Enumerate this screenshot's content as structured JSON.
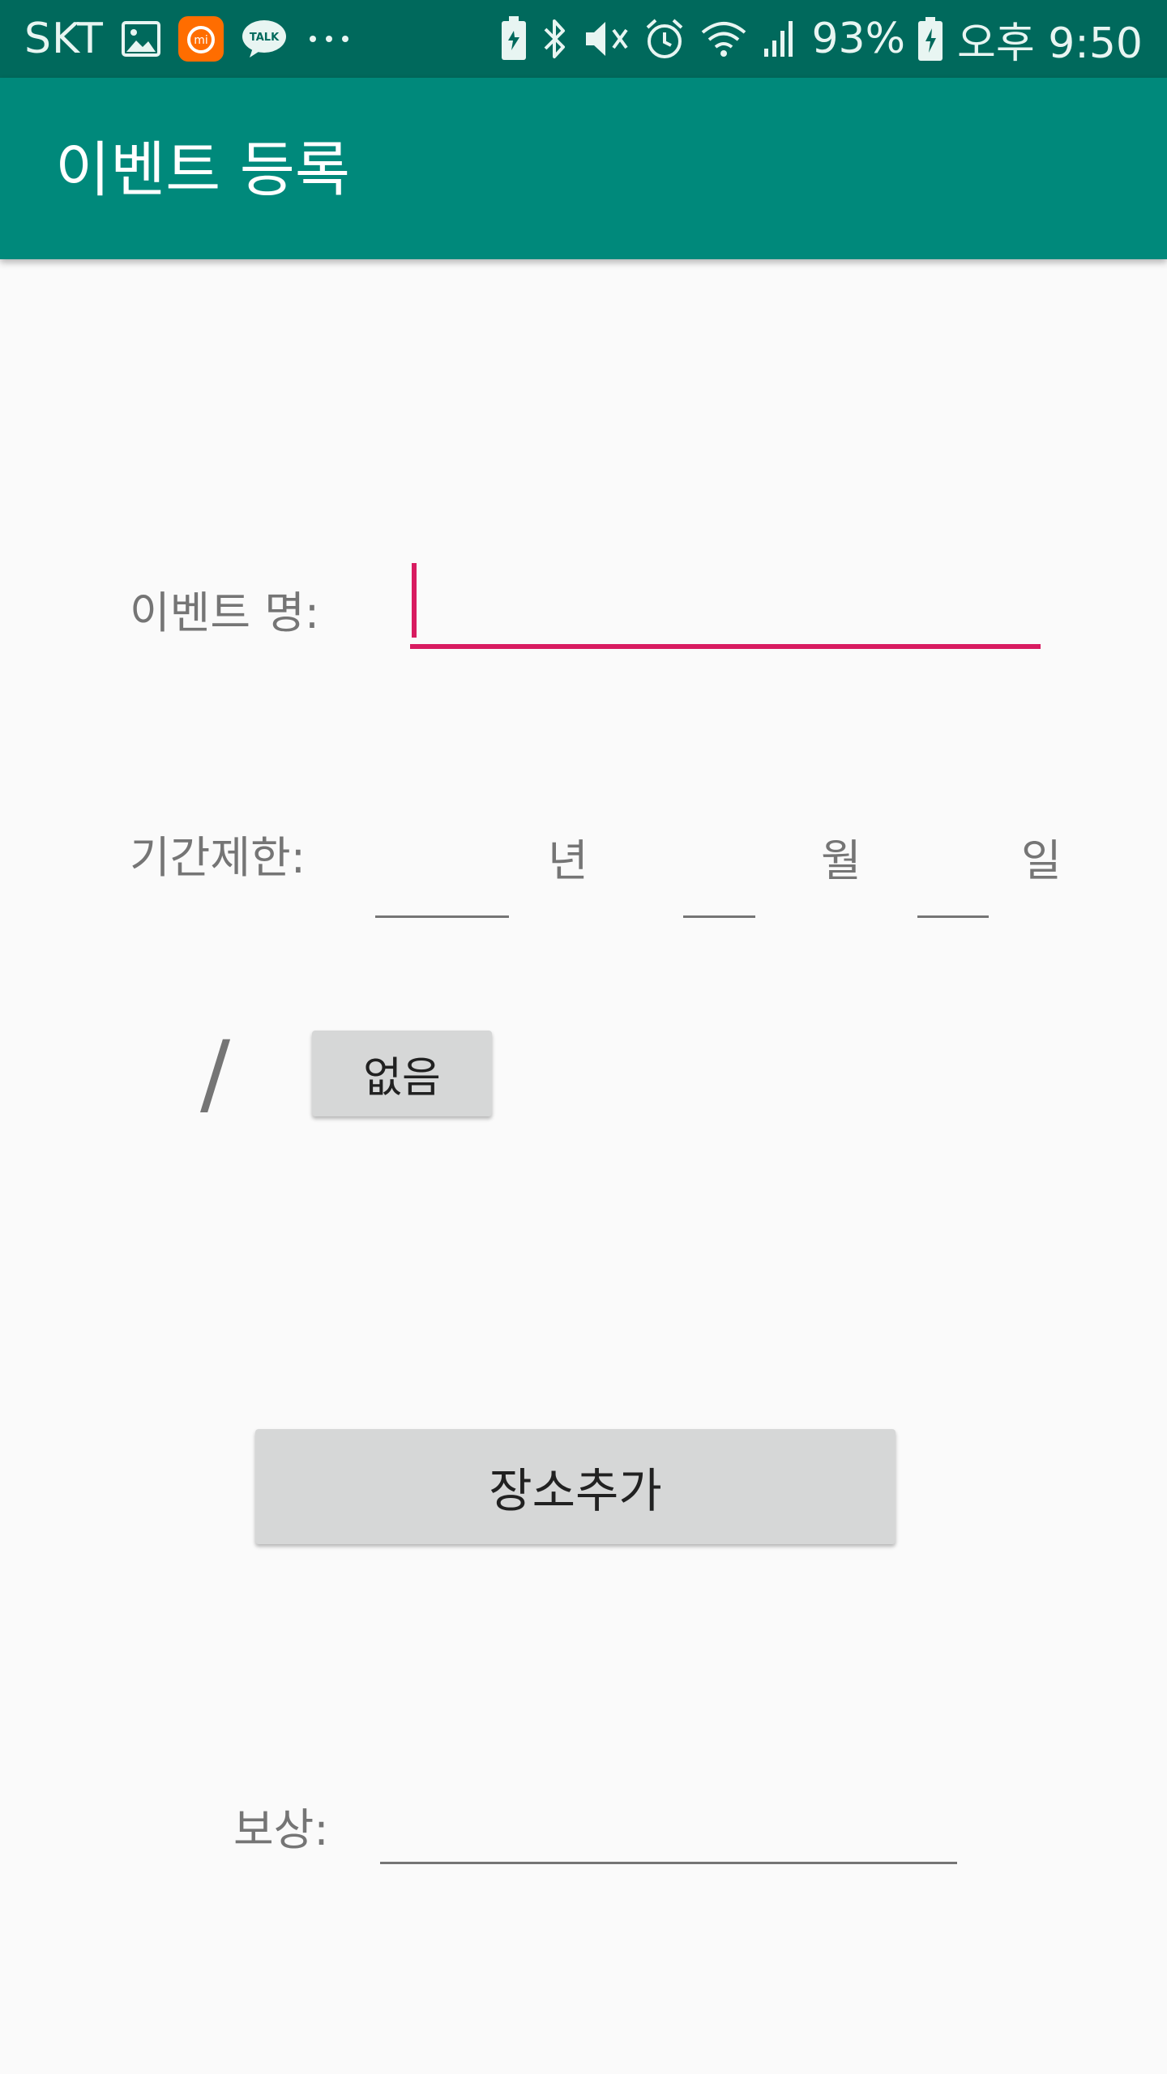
{
  "status_bar": {
    "carrier": "SKT",
    "left_icons": [
      "gallery-icon",
      "mi-app-icon",
      "kakaotalk-icon",
      "more-notifications-icon"
    ],
    "talk_badge": "TALK",
    "right_icons": [
      "battery-saver-icon",
      "bluetooth-icon",
      "mute-icon",
      "alarm-icon",
      "wifi-icon",
      "signal-icon",
      "battery-icon"
    ],
    "battery_percent": "93%",
    "time": "오후 9:50"
  },
  "app_bar": {
    "title": "이벤트 등록",
    "color": "#00897b"
  },
  "form": {
    "event_name": {
      "label": "이벤트 명:",
      "value": "",
      "accent": "#d81b60"
    },
    "deadline": {
      "label": "기간제한:",
      "year_unit": "년",
      "month_unit": "월",
      "day_unit": "일",
      "year_value": "",
      "month_value": "",
      "day_value": ""
    },
    "slash": "/",
    "none_button": "없음",
    "add_place_button": "장소추가",
    "reward": {
      "label": "보상:",
      "value": ""
    }
  }
}
